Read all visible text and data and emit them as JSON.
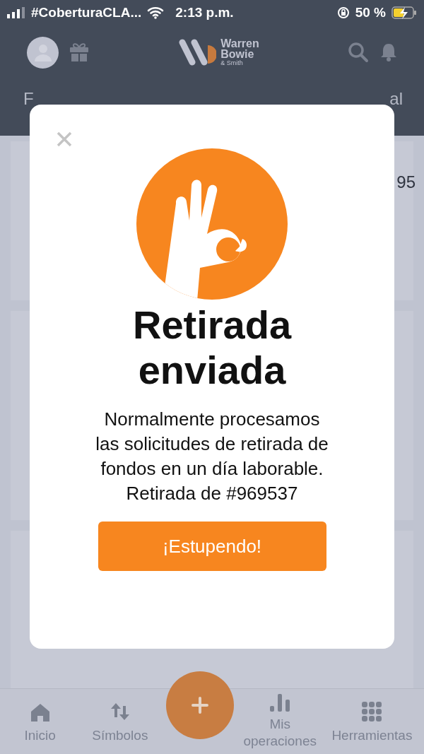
{
  "status_bar": {
    "carrier": "#CoberturaCLA...",
    "time": "2:13 p.m.",
    "battery": "50 %"
  },
  "header": {
    "logo_lines": [
      "Warren",
      "Bowie",
      "& Smith"
    ]
  },
  "background_tabs": [
    "F",
    "al"
  ],
  "background_card": {
    "value": "95"
  },
  "modal": {
    "title": "Retirada enviada",
    "message": "Normalmente procesamos las solicitudes de retirada de fondos en un día laborable. Retirada de #969537",
    "button": "¡Estupendo!"
  },
  "bottom_nav": [
    {
      "kind": "tab",
      "label": "Inicio"
    },
    {
      "kind": "tab",
      "label": "Símbolos"
    },
    {
      "kind": "fab"
    },
    {
      "kind": "tab",
      "label": "Mis operaciones"
    },
    {
      "kind": "tab",
      "label": "Herramientas"
    }
  ]
}
